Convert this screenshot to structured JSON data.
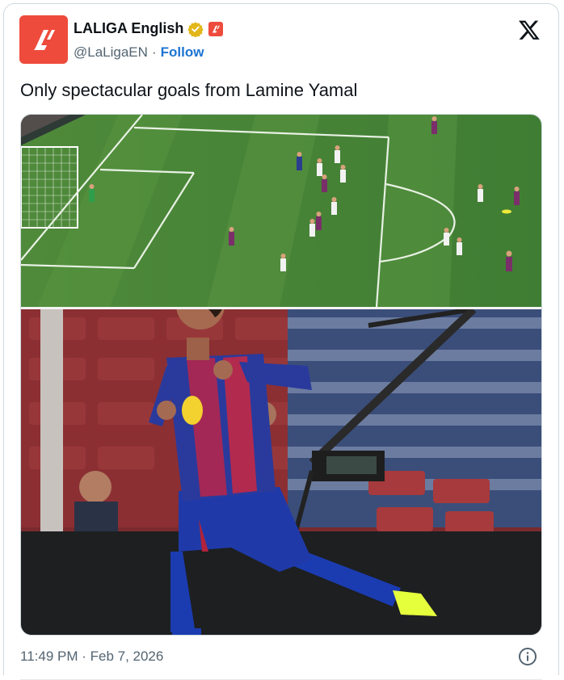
{
  "author": {
    "display_name": "LALIGA English",
    "handle": "@LaLigaEN",
    "separator": "·",
    "follow_label": "Follow"
  },
  "tweet": {
    "text": "Only spectacular goals from Lamine Yamal",
    "timestamp": "11:49 PM · Feb 7, 2026"
  },
  "media": {
    "top_image": "football-pitch-goal-action",
    "bottom_image": "player-celebration-photo"
  },
  "colors": {
    "brand_red": "#ee4b3c",
    "follow_blue": "#1d74d2",
    "secondary_text": "#536471",
    "verified_gold": "#e2b719"
  },
  "icons": [
    "laliga-logo-icon",
    "verified-badge-icon",
    "affiliate-badge-icon",
    "x-logo-icon",
    "info-icon"
  ]
}
